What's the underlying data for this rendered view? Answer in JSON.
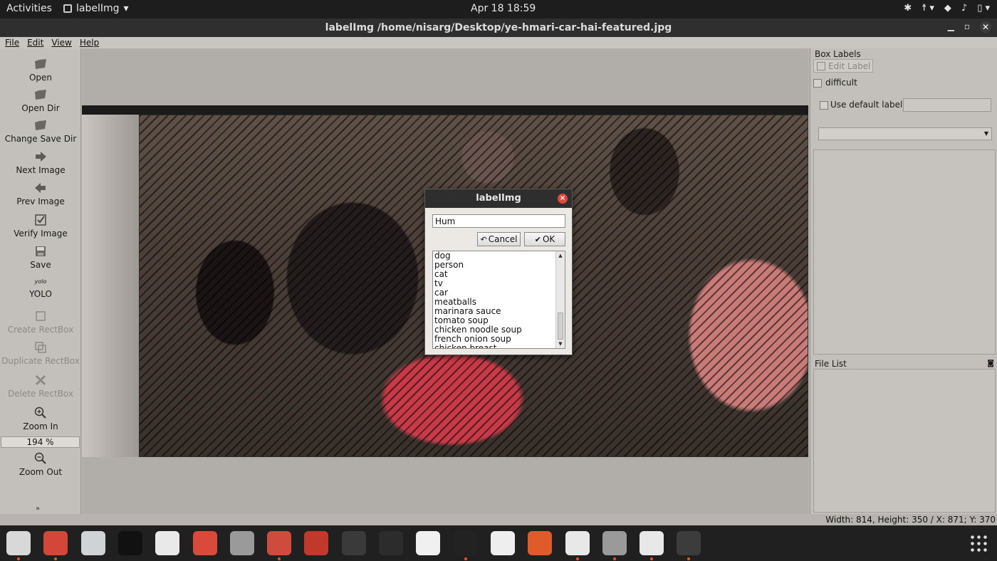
{
  "topbar": {
    "activities": "Activities",
    "app_menu": "labelImg",
    "clock": "Apr 18  18:59",
    "tray_icons": [
      "extension-icon",
      "accessibility-icon",
      "wifi-icon",
      "microphone-icon",
      "battery-icon"
    ]
  },
  "window": {
    "title": "labelImg /home/nisarg/Desktop/ye-hmari-car-hai-featured.jpg",
    "buttons": [
      "minimize-icon",
      "maximize-icon",
      "close-icon"
    ]
  },
  "menu": {
    "file": "File",
    "edit": "Edit",
    "view": "View",
    "help": "Help"
  },
  "toolbar": {
    "open": "Open",
    "open_dir": "Open Dir",
    "change_save_dir": "Change Save Dir",
    "next_image": "Next Image",
    "prev_image": "Prev Image",
    "verify_image": "Verify Image",
    "save": "Save",
    "yolo_icon_text": "yolo",
    "yolo": "YOLO",
    "create_rectbox": "Create RectBox",
    "duplicate_rectbox": "Duplicate RectBox",
    "delete_rectbox": "Delete RectBox",
    "zoom_in": "Zoom In",
    "zoom_value": "194 %",
    "zoom_out": "Zoom Out",
    "expand": "»"
  },
  "right_panel": {
    "box_labels_title": "Box Labels",
    "edit_label": "Edit Label",
    "difficult": "difficult",
    "use_default_label": "Use default label",
    "default_label_value": "",
    "file_list_title": "File List"
  },
  "status": {
    "text": "Width: 814, Height: 350 / X: 871; Y: 370"
  },
  "dialog": {
    "title": "labelImg",
    "input_value": "Hum",
    "cancel": "Cancel",
    "ok": "OK",
    "labels": [
      "dog",
      "person",
      "cat",
      "tv",
      "car",
      "meatballs",
      "marinara sauce",
      "tomato soup",
      "chicken noodle soup",
      "french onion soup",
      "chicken breast"
    ]
  },
  "dock": {
    "apps": [
      "files",
      "firefox",
      "thunderbird",
      "rhythmbox",
      "libreoffice-writer",
      "software-center",
      "help",
      "chromium",
      "sublime-text",
      "vscode",
      "spotify",
      "text-editor",
      "terminal",
      "document-viewer",
      "brave",
      "image-editor",
      "labelimg",
      "image-viewer",
      "system-monitor"
    ],
    "show_apps": "show-applications-icon"
  },
  "colors": {
    "topbar": "#1d1d1d",
    "dock": "#202020",
    "dialog_close": "#e0483e",
    "dock_running": "#e95420"
  }
}
